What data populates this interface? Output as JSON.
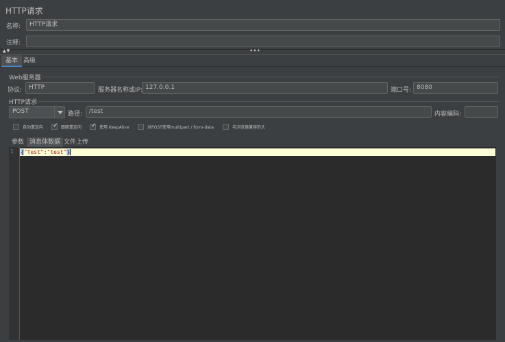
{
  "panel": {
    "title": "HTTP请求"
  },
  "fields": {
    "name_label": "名称:",
    "name_value": "HTTP请求",
    "comment_label": "注释:",
    "comment_value": ""
  },
  "splitter": {
    "arrows": "▲▼",
    "dots": "•••"
  },
  "tabs": [
    {
      "label": "基本",
      "active": true
    },
    {
      "label": "高级",
      "active": false
    }
  ],
  "web_server": {
    "title": "Web服务器",
    "protocol_label": "协议:",
    "protocol_value": "HTTP",
    "server_label": "服务器名称或IP:",
    "server_value": "127.0.0.1",
    "port_label": "端口号:",
    "port_value": "8080"
  },
  "http_request": {
    "title": "HTTP请求",
    "method": "POST",
    "path_label": "路径:",
    "path_value": "/test",
    "encoding_label": "内容编码:",
    "encoding_value": ""
  },
  "options": [
    {
      "label": "自动重定向",
      "checked": false
    },
    {
      "label": "跟随重定向",
      "checked": true
    },
    {
      "label": "使用 KeepAlive",
      "checked": true
    },
    {
      "label": "对POST使用multipart / form-data",
      "checked": false
    },
    {
      "label": "与浏览器兼容的头",
      "checked": false
    }
  ],
  "subtabs": [
    {
      "label": "参数",
      "active": false
    },
    {
      "label": "消息体数据",
      "active": true
    },
    {
      "label": "文件上传",
      "active": false
    }
  ],
  "editor": {
    "line_number": "1",
    "open_brace": "{",
    "body": "\"Test\":\"test\"",
    "close_brace": "}"
  },
  "colors": {
    "background": "#3c3f41",
    "field_bg": "#45494a",
    "editor_bg": "#2b2b2b",
    "current_line": "#ffffd7",
    "active_tab_underline": "#4a88c7"
  }
}
